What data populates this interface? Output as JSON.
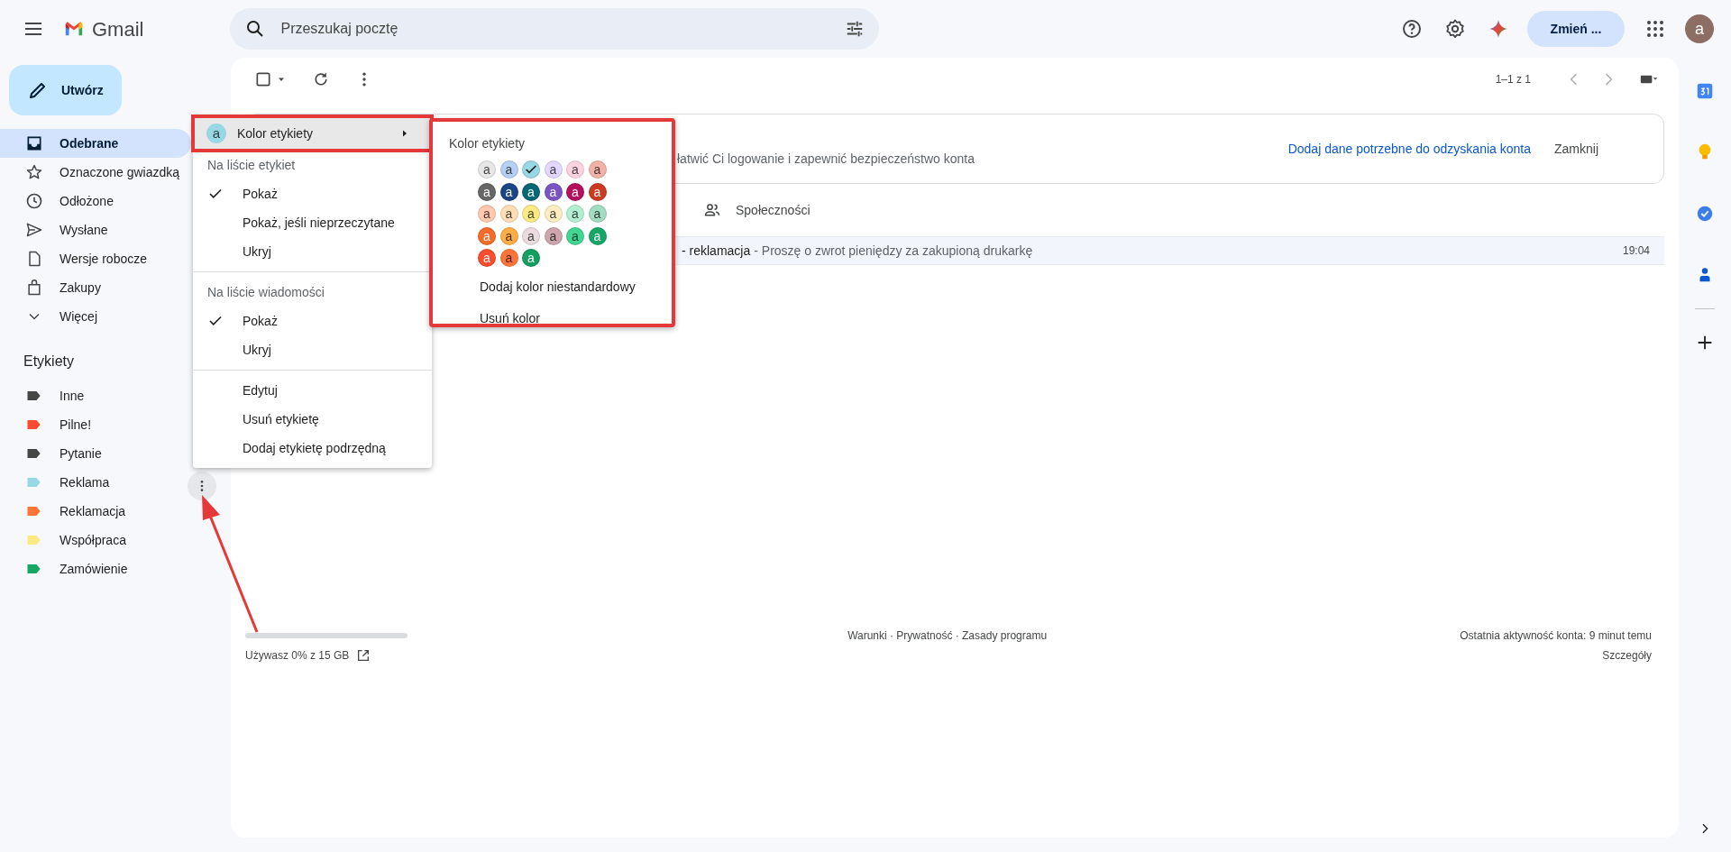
{
  "header": {
    "logo_text": "Gmail",
    "search": {
      "placeholder": "Przeszukaj pocztę"
    },
    "upgrade_button": "Zmień ...",
    "avatar": "a"
  },
  "compose": "Utwórz",
  "nav": [
    {
      "kind": "inbox",
      "label": "Odebrane",
      "selected": true
    },
    {
      "kind": "star",
      "label": "Oznaczone gwiazdką",
      "selected": false
    },
    {
      "kind": "clock",
      "label": "Odłożone",
      "selected": false
    },
    {
      "kind": "send",
      "label": "Wysłane",
      "selected": false
    },
    {
      "kind": "draft",
      "label": "Wersje robocze",
      "selected": false
    },
    {
      "kind": "bag",
      "label": "Zakupy",
      "selected": false
    },
    {
      "kind": "more",
      "label": "Więcej",
      "selected": false
    }
  ],
  "labels_heading": "Etykiety",
  "labels": [
    {
      "name": "Inne",
      "color": "#444746",
      "menu_open": false
    },
    {
      "name": "Pilne!",
      "color": "#fb4c2f",
      "menu_open": false
    },
    {
      "name": "Pytanie",
      "color": "#444746",
      "menu_open": false
    },
    {
      "name": "Reklama",
      "color": "#98d7e4",
      "menu_open": true
    },
    {
      "name": "Reklamacja",
      "color": "#ff7537",
      "menu_open": false
    },
    {
      "name": "Współpraca",
      "color": "#fbe983",
      "menu_open": false
    },
    {
      "name": "Zamówienie",
      "color": "#16a766",
      "menu_open": false
    }
  ],
  "toolbar": {
    "pagination": "1–1 z 1"
  },
  "banner": {
    "text": "łatwić Ci logowanie i zapewnić bezpieczeństwo konta",
    "action": "Dodaj dane potrzebne do odzyskania konta",
    "dismiss": "Zamknij"
  },
  "tabs": [
    {
      "label": "Społeczności",
      "selected": false
    }
  ],
  "messages": [
    {
      "subject": "- reklamacja",
      "snippet": "- Proszę o zwrot pieniędzy za zakupioną drukarkę",
      "time": "19:04"
    }
  ],
  "footer": {
    "storage_text": "Używasz 0% z 15 GB",
    "storage": {
      "level": 0
    },
    "links": "Warunki · Prywatność · Zasady programu",
    "activity": "Ostatnia aktywność konta: 9 minut temu",
    "details": "Szczegóły"
  },
  "label_menu": {
    "items": [
      {
        "kind": "submenu",
        "label": "Kolor etykiety",
        "color": "#98d7e4",
        "swatch_text": "a",
        "highlighted": true
      },
      {
        "kind": "header",
        "label": "Na liście etykiet"
      },
      {
        "kind": "option",
        "label": "Pokaż",
        "checked": true
      },
      {
        "kind": "option",
        "label": "Pokaż, jeśli nieprzeczytane",
        "checked": false
      },
      {
        "kind": "option",
        "label": "Ukryj",
        "checked": false
      },
      {
        "kind": "divider"
      },
      {
        "kind": "header",
        "label": "Na liście wiadomości"
      },
      {
        "kind": "option",
        "label": "Pokaż",
        "checked": true
      },
      {
        "kind": "option",
        "label": "Ukryj",
        "checked": false
      },
      {
        "kind": "divider"
      },
      {
        "kind": "action",
        "label": "Edytuj"
      },
      {
        "kind": "action",
        "label": "Usuń etykietę"
      },
      {
        "kind": "action",
        "label": "Dodaj etykietę podrzędną"
      }
    ]
  },
  "color_submenu": {
    "title": "Kolor etykiety",
    "highlighted": true,
    "swatches": [
      {
        "color": "#e7e7e7",
        "label": "a",
        "selected": false
      },
      {
        "color": "#b6cff5",
        "label": "a",
        "selected": false
      },
      {
        "color": "#98d7e4",
        "selected": true
      },
      {
        "color": "#e3d7ff",
        "label": "a",
        "selected": false
      },
      {
        "color": "#fbd3e0",
        "label": "a",
        "selected": false
      },
      {
        "color": "#f2b2a8",
        "label": "a",
        "selected": false
      },
      {
        "color": "#666666",
        "label": "a",
        "selected": false
      },
      {
        "color": "#1c4587",
        "label": "a",
        "selected": false
      },
      {
        "color": "#076875",
        "label": "a",
        "selected": false
      },
      {
        "color": "#7a54c4",
        "label": "a",
        "selected": false
      },
      {
        "color": "#b3105e",
        "label": "a",
        "selected": false
      },
      {
        "color": "#cc3a21",
        "label": "a",
        "selected": false
      },
      {
        "color": "#ffc8af",
        "label": "a",
        "selected": false
      },
      {
        "color": "#ffdeb5",
        "label": "a",
        "selected": false
      },
      {
        "color": "#fbe983",
        "label": "a",
        "selected": false
      },
      {
        "color": "#fdedc1",
        "label": "a",
        "selected": false
      },
      {
        "color": "#b3efd3",
        "label": "a",
        "selected": false
      },
      {
        "color": "#a2dcc1",
        "label": "a",
        "selected": false
      },
      {
        "color": "#f56b2a",
        "label": "a",
        "selected": false
      },
      {
        "color": "#ffad46",
        "label": "a",
        "selected": false
      },
      {
        "color": "#ebdbde",
        "label": "a",
        "selected": false
      },
      {
        "color": "#cca6ac",
        "label": "a",
        "selected": false
      },
      {
        "color": "#42d692",
        "label": "a",
        "selected": false
      },
      {
        "color": "#16a766",
        "label": "a",
        "selected": false
      },
      {
        "color": "#fb4c2f",
        "label": "a",
        "selected": false
      },
      {
        "color": "#ff7537",
        "label": "a",
        "selected": false
      },
      {
        "color": "#149e60",
        "label": "a",
        "selected": false
      }
    ],
    "actions": [
      "Dodaj kolor niestandardowy",
      "Usuń kolor"
    ]
  },
  "annotation": {
    "arrow": true
  }
}
